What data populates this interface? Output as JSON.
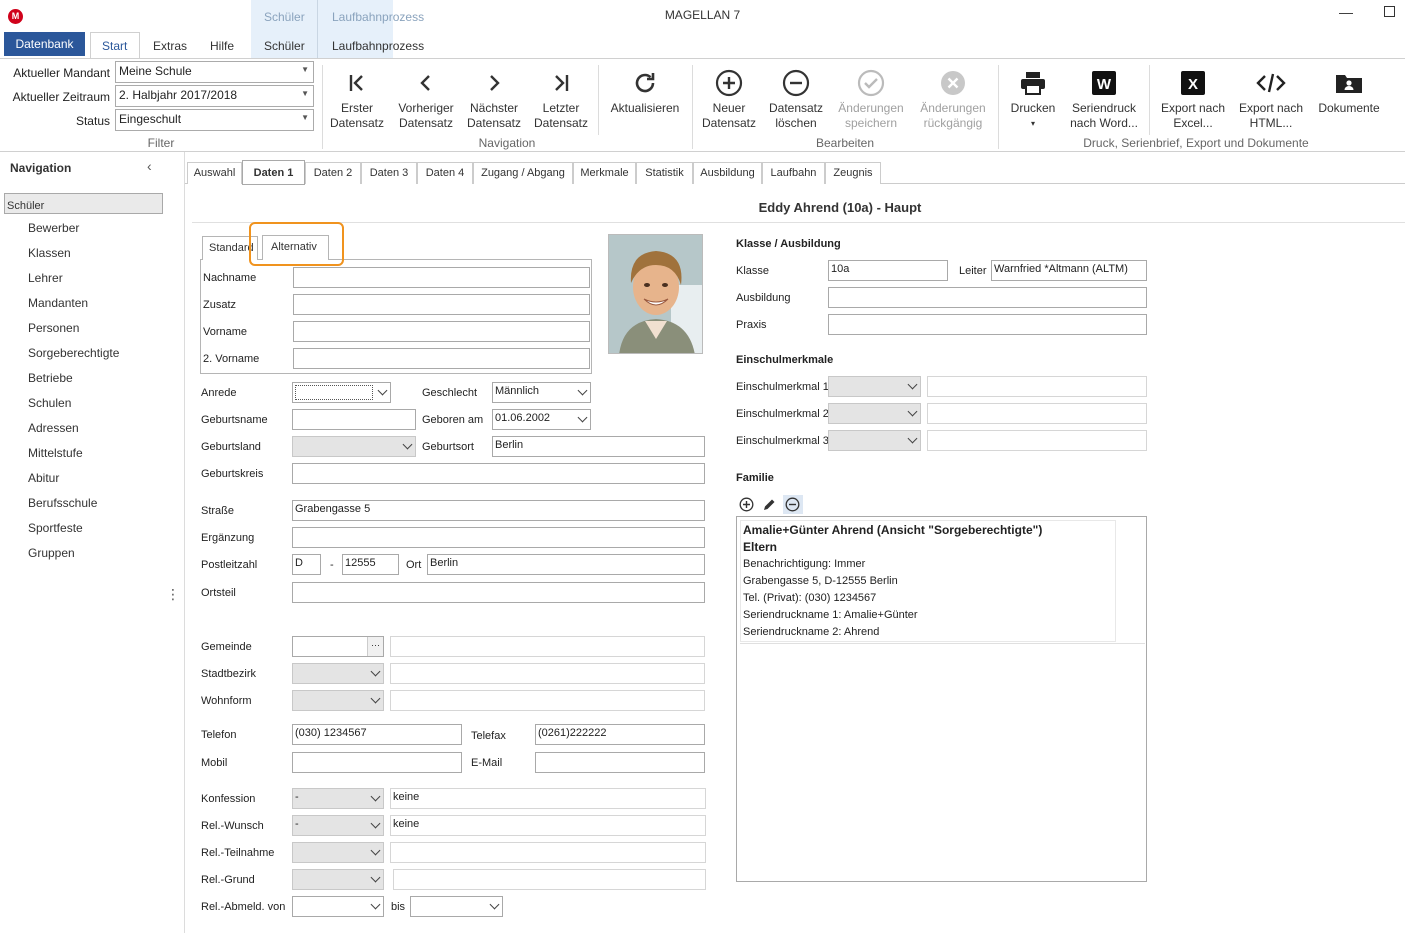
{
  "window": {
    "title": "MAGELLAN 7",
    "logo": "M"
  },
  "context_tabs": [
    {
      "group": "Schüler",
      "tab": "Schüler"
    },
    {
      "group": "Laufbahnprozess",
      "tab": "Laufbahnprozess"
    }
  ],
  "ribbon_tabs": [
    "Datenbank",
    "Start",
    "Extras",
    "Hilfe"
  ],
  "filter": {
    "mandant_label": "Aktueller Mandant",
    "mandant_value": "Meine Schule",
    "zeitraum_label": "Aktueller Zeitraum",
    "zeitraum_value": "2. Halbjahr 2017/2018",
    "status_label": "Status",
    "status_value": "Eingeschult",
    "group_label": "Filter"
  },
  "navigation_group": {
    "label": "Navigation",
    "buttons": [
      {
        "line1": "Erster",
        "line2": "Datensatz",
        "icon": "first-record-icon"
      },
      {
        "line1": "Vorheriger",
        "line2": "Datensatz",
        "icon": "previous-record-icon"
      },
      {
        "line1": "Nächster",
        "line2": "Datensatz",
        "icon": "next-record-icon"
      },
      {
        "line1": "Letzter",
        "line2": "Datensatz",
        "icon": "last-record-icon"
      },
      {
        "line1": "Aktualisieren",
        "line2": "",
        "icon": "refresh-icon"
      }
    ]
  },
  "edit_group": {
    "label": "Bearbeiten",
    "buttons": [
      {
        "line1": "Neuer",
        "line2": "Datensatz",
        "icon": "add-circle-icon"
      },
      {
        "line1": "Datensatz",
        "line2": "löschen",
        "icon": "remove-circle-icon"
      },
      {
        "line1": "Änderungen",
        "line2": "speichern",
        "icon": "check-circle-icon",
        "disabled": true
      },
      {
        "line1": "Änderungen",
        "line2": "rückgängig",
        "icon": "cancel-circle-icon",
        "disabled": true
      }
    ]
  },
  "print_group": {
    "label": "Druck, Serienbrief, Export und Dokumente",
    "buttons": [
      {
        "line1": "Drucken",
        "line2": "▾",
        "icon": "printer-icon"
      },
      {
        "line1": "Seriendruck",
        "line2": "nach Word...",
        "icon": "word-icon"
      },
      {
        "line1": "Export nach",
        "line2": "Excel...",
        "icon": "excel-icon"
      },
      {
        "line1": "Export nach",
        "line2": "HTML...",
        "icon": "html-icon"
      },
      {
        "line1": "Dokumente",
        "line2": "",
        "icon": "documents-icon"
      }
    ]
  },
  "nav": {
    "title": "Navigation",
    "items": [
      "Schüler",
      "Bewerber",
      "Klassen",
      "Lehrer",
      "Mandanten",
      "Personen",
      "Sorgeberechtigte",
      "Betriebe",
      "Schulen",
      "Adressen",
      "Mittelstufe",
      "Abitur",
      "Berufsschule",
      "Sportfeste",
      "Gruppen"
    ]
  },
  "tabs": [
    "Auswahl",
    "Daten 1",
    "Daten 2",
    "Daten 3",
    "Daten 4",
    "Zugang / Abgang",
    "Merkmale",
    "Statistik",
    "Ausbildung",
    "Laufbahn",
    "Zeugnis"
  ],
  "header": "Eddy Ahrend (10a) - Haupt",
  "name_tabs": [
    "Standard",
    "Alternativ"
  ],
  "name_fields": {
    "nachname": "Nachname",
    "zusatz": "Zusatz",
    "vorname": "Vorname",
    "vorname2": "2. Vorname"
  },
  "form": {
    "anrede_label": "Anrede",
    "geschlecht_label": "Geschlecht",
    "geschlecht_value": "Männlich",
    "geburtsname_label": "Geburtsname",
    "geboren_label": "Geboren am",
    "geboren_value": "01.06.2002",
    "geburtsland_label": "Geburtsland",
    "geburtsort_label": "Geburtsort",
    "geburtsort_value": "Berlin",
    "geburtskreis_label": "Geburtskreis",
    "strasse_label": "Straße",
    "strasse_value": "Grabengasse 5",
    "ergaenzung_label": "Ergänzung",
    "plz_label": "Postleitzahl",
    "land_value": "D",
    "plz_dash": "-",
    "plz_value": "12555",
    "ort_label": "Ort",
    "ort_value": "Berlin",
    "ortsteil_label": "Ortsteil",
    "gemeinde_label": "Gemeinde",
    "gemeinde_btn": "···",
    "stadtbezirk_label": "Stadtbezirk",
    "wohnform_label": "Wohnform",
    "telefon_label": "Telefon",
    "telefon_value": "(030) 1234567",
    "telefax_label": "Telefax",
    "telefax_value": "(0261)222222",
    "mobil_label": "Mobil",
    "email_label": "E-Mail",
    "konfession_label": "Konfession",
    "konfession_value": "-",
    "konfession_text": "keine",
    "relwunsch_label": "Rel.-Wunsch",
    "relwunsch_value": "-",
    "relwunsch_text": "keine",
    "relteilnahme_label": "Rel.-Teilnahme",
    "relgrund_label": "Rel.-Grund",
    "relabmeld_label": "Rel.-Abmeld. von",
    "bis_label": "bis"
  },
  "klasse": {
    "title": "Klasse / Ausbildung",
    "klasse_label": "Klasse",
    "klasse_value": "10a",
    "leiter_label": "Leiter",
    "leiter_value": "Warnfried *Altmann (ALTM)",
    "ausbildung_label": "Ausbildung",
    "praxis_label": "Praxis"
  },
  "einschul": {
    "title": "Einschulmerkmale",
    "labels": [
      "Einschulmerkmal 1",
      "Einschulmerkmal 2",
      "Einschulmerkmal 3"
    ]
  },
  "familie": {
    "title": "Familie",
    "name": "Amalie+Günter Ahrend (Ansicht \"Sorgeberechtigte\")",
    "role": "Eltern",
    "lines": [
      "Benachrichtigung: Immer",
      "Grabengasse 5, D-12555 Berlin",
      "Tel. (Privat): (030) 1234567",
      "Seriendruckname 1: Amalie+Günter",
      "Seriendruckname 2: Ahrend"
    ]
  },
  "colors": {
    "accent": "#2b579a",
    "highlight": "#f0931e"
  }
}
